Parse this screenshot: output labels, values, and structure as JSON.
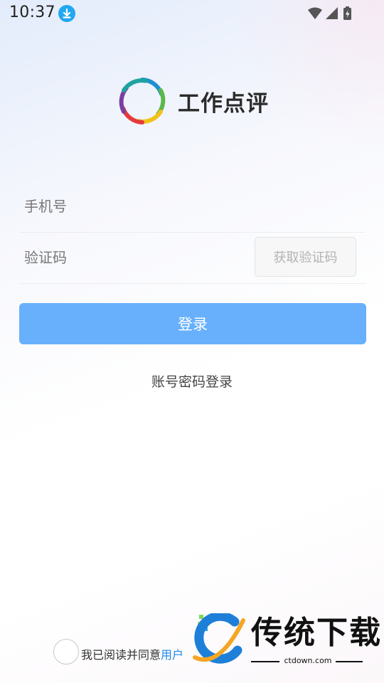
{
  "status_bar": {
    "time": "10:37",
    "icons": [
      "download-icon",
      "wifi-icon",
      "cell-signal-icon",
      "battery-charging-icon"
    ]
  },
  "app": {
    "name": "工作点评",
    "logo_colors": [
      "#1f8fcf",
      "#5ab84a",
      "#f2c21c",
      "#e53a3a",
      "#7b3fa0",
      "#1fa3a0"
    ]
  },
  "form": {
    "phone_placeholder": "手机号",
    "code_placeholder": "验证码",
    "get_code_label": "获取验证码",
    "login_label": "登录",
    "alt_login_label": "账号密码登录"
  },
  "agreement": {
    "prefix": "我已阅读并同意",
    "link_text": "用户"
  },
  "watermark": {
    "title": "传统下载",
    "site": "ctdown.com"
  },
  "colors": {
    "primary": "#68b0fb",
    "link": "#1e88e5",
    "status_badge": "#22a7f0"
  }
}
